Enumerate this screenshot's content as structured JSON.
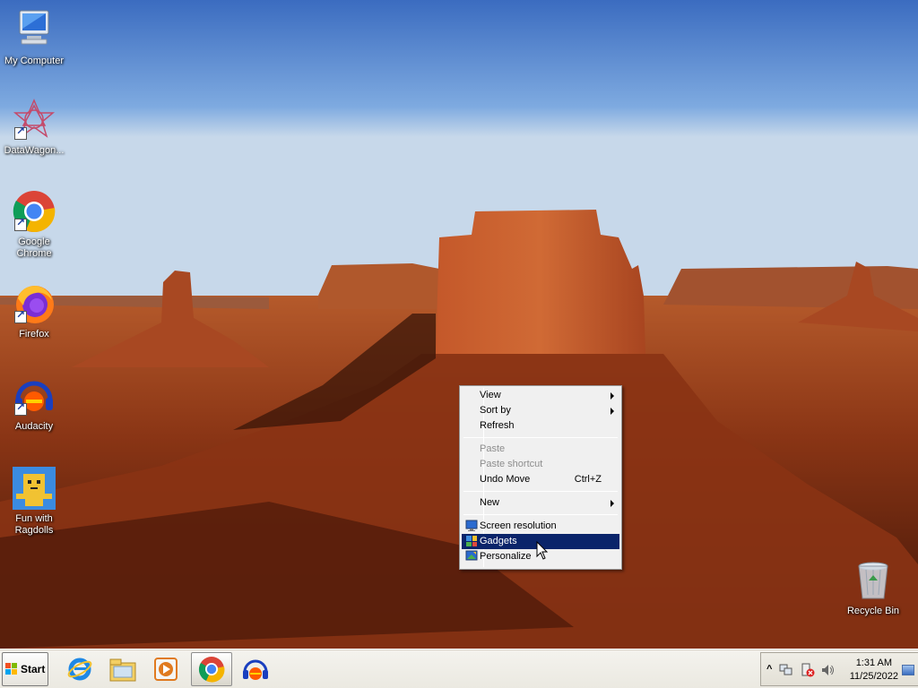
{
  "desktop": {
    "icons": [
      {
        "label": "My Computer",
        "icon": "computer-icon"
      },
      {
        "label": "DataWagon...",
        "icon": "datawagon-icon"
      },
      {
        "label": "Google Chrome",
        "icon": "chrome-icon"
      },
      {
        "label": "Firefox",
        "icon": "firefox-icon"
      },
      {
        "label": "Audacity",
        "icon": "audacity-icon"
      },
      {
        "label": "Fun with Ragdolls",
        "icon": "ragdolls-icon"
      },
      {
        "label": "Recycle Bin",
        "icon": "recycle-bin-icon"
      }
    ]
  },
  "context_menu": {
    "view": "View",
    "sort_by": "Sort by",
    "refresh": "Refresh",
    "paste": "Paste",
    "paste_shortcut": "Paste shortcut",
    "undo_move": "Undo Move",
    "undo_accel": "Ctrl+Z",
    "new": "New",
    "screen_resolution": "Screen resolution",
    "gadgets": "Gadgets",
    "personalize": "Personalize"
  },
  "taskbar": {
    "start_label": "Start",
    "pinned": [
      {
        "icon": "internet-explorer-icon"
      },
      {
        "icon": "file-explorer-icon"
      },
      {
        "icon": "media-player-icon"
      },
      {
        "icon": "chrome-icon"
      },
      {
        "icon": "audacity-icon"
      }
    ],
    "tray": {
      "expand": "^",
      "time": "1:31 AM",
      "date": "11/25/2022"
    }
  },
  "colors": {
    "menu_highlight": "#0a246a",
    "taskbar_bg": "#ebe9e1"
  }
}
